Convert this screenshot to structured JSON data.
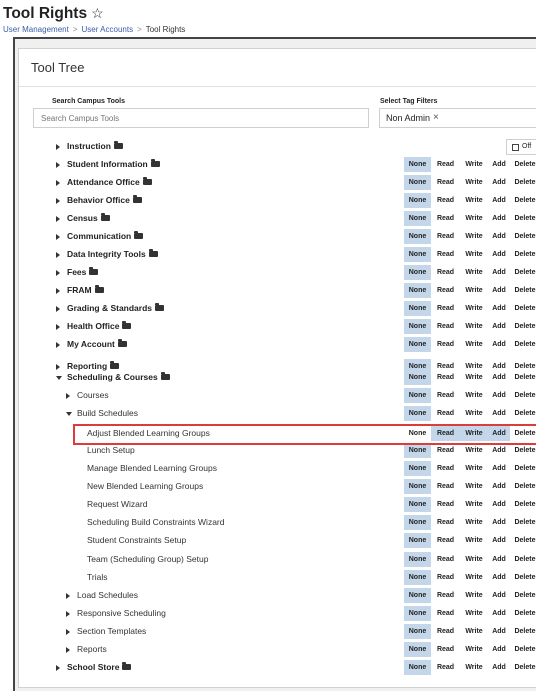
{
  "header": {
    "title": "Tool Rights",
    "star": "☆",
    "breadcrumb": [
      "User Management",
      "User Accounts",
      "Tool Rights"
    ],
    "separator": ">"
  },
  "card": {
    "title": "Tool Tree",
    "search_label": "Search Campus Tools",
    "search_placeholder": "Search Campus Tools",
    "tag_label": "Select Tag Filters",
    "tag_value": "Non Admin",
    "tag_remove": "×",
    "off_label": "Off"
  },
  "perm_labels": [
    "None",
    "Read",
    "Write",
    "Add",
    "Delete"
  ],
  "colors": {
    "selected": "#c4d7ea",
    "highlight": "#dd3c3c",
    "link": "#3a5ea8"
  },
  "rows": [
    {
      "label": "Instruction",
      "level": 0,
      "bold": true,
      "folder": true,
      "arrow": "right",
      "perms": false,
      "selected": []
    },
    {
      "label": "Student Information",
      "level": 0,
      "bold": true,
      "folder": true,
      "arrow": "right",
      "perms": true,
      "selected": [
        0
      ]
    },
    {
      "label": "Attendance Office",
      "level": 0,
      "bold": true,
      "folder": true,
      "arrow": "right",
      "perms": true,
      "selected": [
        0
      ]
    },
    {
      "label": "Behavior Office",
      "level": 0,
      "bold": true,
      "folder": true,
      "arrow": "right",
      "perms": true,
      "selected": [
        0
      ]
    },
    {
      "label": "Census",
      "level": 0,
      "bold": true,
      "folder": true,
      "arrow": "right",
      "perms": true,
      "selected": [
        0
      ]
    },
    {
      "label": "Communication",
      "level": 0,
      "bold": true,
      "folder": true,
      "arrow": "right",
      "perms": true,
      "selected": [
        0
      ]
    },
    {
      "label": "Data Integrity Tools",
      "level": 0,
      "bold": true,
      "folder": true,
      "arrow": "right",
      "perms": true,
      "selected": [
        0
      ]
    },
    {
      "label": "Fees",
      "level": 0,
      "bold": true,
      "folder": true,
      "arrow": "right",
      "perms": true,
      "selected": [
        0
      ]
    },
    {
      "label": "FRAM",
      "level": 0,
      "bold": true,
      "folder": true,
      "arrow": "right",
      "perms": true,
      "selected": [
        0
      ]
    },
    {
      "label": "Grading & Standards",
      "level": 0,
      "bold": true,
      "folder": true,
      "arrow": "right",
      "perms": true,
      "selected": [
        0
      ]
    },
    {
      "label": "Health Office",
      "level": 0,
      "bold": true,
      "folder": true,
      "arrow": "right",
      "perms": true,
      "selected": [
        0
      ]
    },
    {
      "label": "My Account",
      "level": 0,
      "bold": true,
      "folder": true,
      "arrow": "right",
      "perms": true,
      "selected": [
        0
      ]
    },
    {
      "label": "Reporting",
      "level": 0,
      "bold": true,
      "folder": true,
      "arrow": "right",
      "perms": true,
      "selected": [
        0
      ]
    },
    {
      "label": "Scheduling & Courses",
      "level": 0,
      "bold": true,
      "folder": true,
      "arrow": "down",
      "perms": true,
      "selected": [
        0
      ]
    },
    {
      "label": "Courses",
      "level": 1,
      "bold": false,
      "folder": false,
      "arrow": "right",
      "perms": true,
      "selected": [
        0
      ]
    },
    {
      "label": "Build Schedules",
      "level": 1,
      "bold": false,
      "folder": false,
      "arrow": "down",
      "perms": true,
      "selected": [
        0
      ]
    },
    {
      "label": "Adjust Blended Learning Groups",
      "level": 2,
      "bold": false,
      "folder": false,
      "arrow": "none",
      "perms": true,
      "selected": [
        1,
        2,
        3
      ]
    },
    {
      "label": "Lunch Setup",
      "level": 2,
      "bold": false,
      "folder": false,
      "arrow": "none",
      "perms": true,
      "selected": [
        0
      ]
    },
    {
      "label": "Manage Blended Learning Groups",
      "level": 2,
      "bold": false,
      "folder": false,
      "arrow": "none",
      "perms": true,
      "selected": [
        0
      ]
    },
    {
      "label": "New Blended Learning Groups",
      "level": 2,
      "bold": false,
      "folder": false,
      "arrow": "none",
      "perms": true,
      "selected": [
        0
      ]
    },
    {
      "label": "Request Wizard",
      "level": 2,
      "bold": false,
      "folder": false,
      "arrow": "none",
      "perms": true,
      "selected": [
        0
      ]
    },
    {
      "label": "Scheduling Build Constraints Wizard",
      "level": 2,
      "bold": false,
      "folder": false,
      "arrow": "none",
      "perms": true,
      "selected": [
        0
      ]
    },
    {
      "label": "Student Constraints Setup",
      "level": 2,
      "bold": false,
      "folder": false,
      "arrow": "none",
      "perms": true,
      "selected": [
        0
      ]
    },
    {
      "label": "Team (Scheduling Group) Setup",
      "level": 2,
      "bold": false,
      "folder": false,
      "arrow": "none",
      "perms": true,
      "selected": [
        0
      ]
    },
    {
      "label": "Trials",
      "level": 2,
      "bold": false,
      "folder": false,
      "arrow": "none",
      "perms": true,
      "selected": [
        0
      ]
    },
    {
      "label": "Load Schedules",
      "level": 1,
      "bold": false,
      "folder": false,
      "arrow": "right",
      "perms": true,
      "selected": [
        0
      ]
    },
    {
      "label": "Responsive Scheduling",
      "level": 1,
      "bold": false,
      "folder": false,
      "arrow": "right",
      "perms": true,
      "selected": [
        0
      ]
    },
    {
      "label": "Section Templates",
      "level": 1,
      "bold": false,
      "folder": false,
      "arrow": "right",
      "perms": true,
      "selected": [
        0
      ]
    },
    {
      "label": "Reports",
      "level": 1,
      "bold": false,
      "folder": false,
      "arrow": "right",
      "perms": true,
      "selected": [
        0
      ]
    },
    {
      "label": "School Store",
      "level": 0,
      "bold": true,
      "folder": true,
      "arrow": "right",
      "perms": true,
      "selected": [
        0
      ]
    }
  ]
}
